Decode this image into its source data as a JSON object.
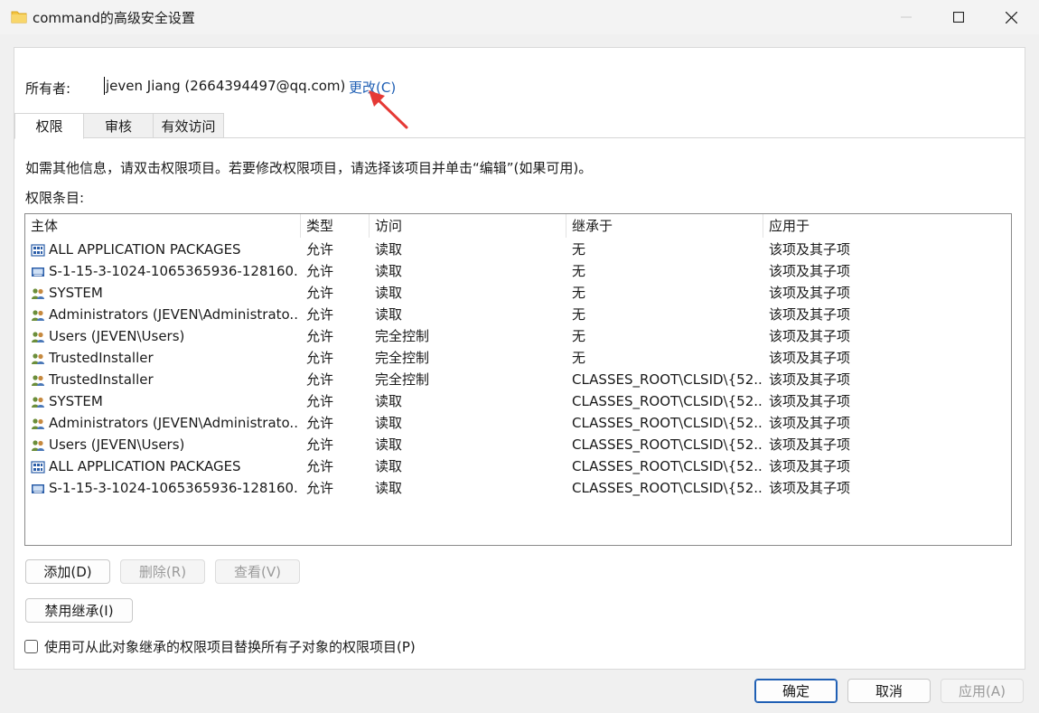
{
  "window": {
    "title": "command的高级安全设置"
  },
  "owner": {
    "label": "所有者:",
    "value": "jeven Jiang (2664394497@qq.com)",
    "change_link": "更改(C)"
  },
  "tabs": [
    {
      "label": "权限",
      "active": true
    },
    {
      "label": "审核",
      "active": false
    },
    {
      "label": "有效访问",
      "active": false
    }
  ],
  "info_text": "如需其他信息，请双击权限项目。若要修改权限项目，请选择该项目并单击“编辑”(如果可用)。",
  "entries_label": "权限条目:",
  "columns": [
    "主体",
    "类型",
    "访问",
    "继承于",
    "应用于"
  ],
  "rows": [
    {
      "icon": "app-packages-icon",
      "principal": "ALL APPLICATION PACKAGES",
      "type": "允许",
      "access": "读取",
      "inherited": "无",
      "applies": "该项及其子项"
    },
    {
      "icon": "sid-icon",
      "principal": "S-1-15-3-1024-1065365936-128160...",
      "type": "允许",
      "access": "读取",
      "inherited": "无",
      "applies": "该项及其子项"
    },
    {
      "icon": "users-icon",
      "principal": "SYSTEM",
      "type": "允许",
      "access": "读取",
      "inherited": "无",
      "applies": "该项及其子项"
    },
    {
      "icon": "users-icon",
      "principal": "Administrators (JEVEN\\Administrato...",
      "type": "允许",
      "access": "读取",
      "inherited": "无",
      "applies": "该项及其子项"
    },
    {
      "icon": "users-icon",
      "principal": "Users (JEVEN\\Users)",
      "type": "允许",
      "access": "完全控制",
      "inherited": "无",
      "applies": "该项及其子项"
    },
    {
      "icon": "users-icon",
      "principal": "TrustedInstaller",
      "type": "允许",
      "access": "完全控制",
      "inherited": "无",
      "applies": "该项及其子项"
    },
    {
      "icon": "users-icon",
      "principal": "TrustedInstaller",
      "type": "允许",
      "access": "完全控制",
      "inherited": "CLASSES_ROOT\\CLSID\\{52...",
      "applies": "该项及其子项"
    },
    {
      "icon": "users-icon",
      "principal": "SYSTEM",
      "type": "允许",
      "access": "读取",
      "inherited": "CLASSES_ROOT\\CLSID\\{52...",
      "applies": "该项及其子项"
    },
    {
      "icon": "users-icon",
      "principal": "Administrators (JEVEN\\Administrato...",
      "type": "允许",
      "access": "读取",
      "inherited": "CLASSES_ROOT\\CLSID\\{52...",
      "applies": "该项及其子项"
    },
    {
      "icon": "users-icon",
      "principal": "Users (JEVEN\\Users)",
      "type": "允许",
      "access": "读取",
      "inherited": "CLASSES_ROOT\\CLSID\\{52...",
      "applies": "该项及其子项"
    },
    {
      "icon": "app-packages-icon",
      "principal": "ALL APPLICATION PACKAGES",
      "type": "允许",
      "access": "读取",
      "inherited": "CLASSES_ROOT\\CLSID\\{52...",
      "applies": "该项及其子项"
    },
    {
      "icon": "sid-icon",
      "principal": "S-1-15-3-1024-1065365936-128160...",
      "type": "允许",
      "access": "读取",
      "inherited": "CLASSES_ROOT\\CLSID\\{52...",
      "applies": "该项及其子项"
    }
  ],
  "buttons": {
    "add": "添加(D)",
    "remove": "删除(R)",
    "view": "查看(V)",
    "disable_inheritance": "禁用继承(I)",
    "ok": "确定",
    "cancel": "取消",
    "apply": "应用(A)"
  },
  "replace_checkbox": {
    "label": "使用可从此对象继承的权限项目替换所有子对象的权限项目(P)",
    "checked": false
  },
  "colors": {
    "link": "#1f5fb4",
    "annotation_arrow": "#e53935",
    "folder": "#f4c542"
  }
}
